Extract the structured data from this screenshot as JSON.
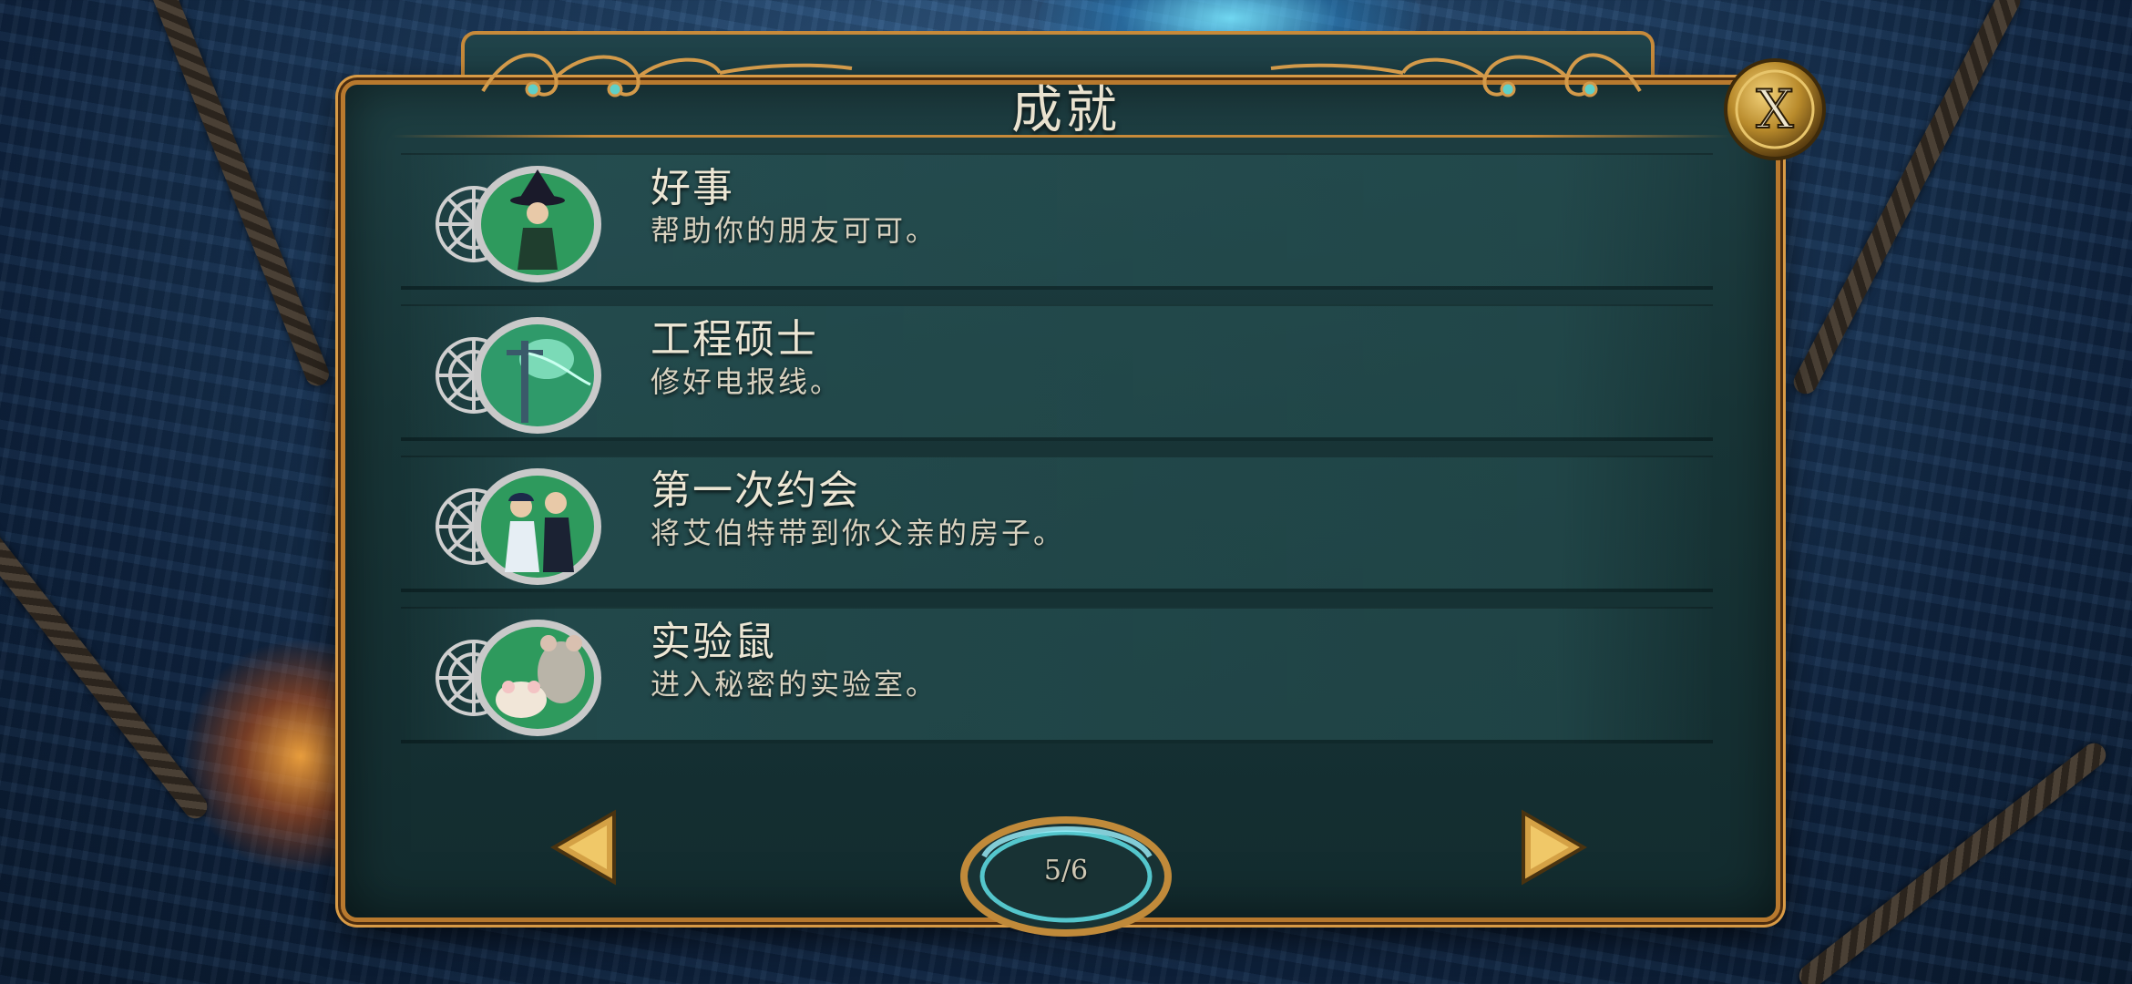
{
  "dialog": {
    "title": "成就",
    "close_label": "X"
  },
  "achievements": [
    {
      "title": "好事",
      "description": "帮助你的朋友可可。",
      "icon": "witch-portrait-icon"
    },
    {
      "title": "工程硕士",
      "description": "修好电报线。",
      "icon": "telegraph-pole-icon"
    },
    {
      "title": "第一次约会",
      "description": "将艾伯特带到你父亲的房子。",
      "icon": "couple-portrait-icon"
    },
    {
      "title": "实验鼠",
      "description": "进入秘密的实验室。",
      "icon": "lab-rats-icon"
    }
  ],
  "pagination": {
    "current": "5/6",
    "prev_icon": "arrow-left-icon",
    "next_icon": "arrow-right-icon"
  },
  "colors": {
    "frame_gold": "#c78a3a",
    "panel_teal": "#183537",
    "text_light": "#ece6d4"
  }
}
